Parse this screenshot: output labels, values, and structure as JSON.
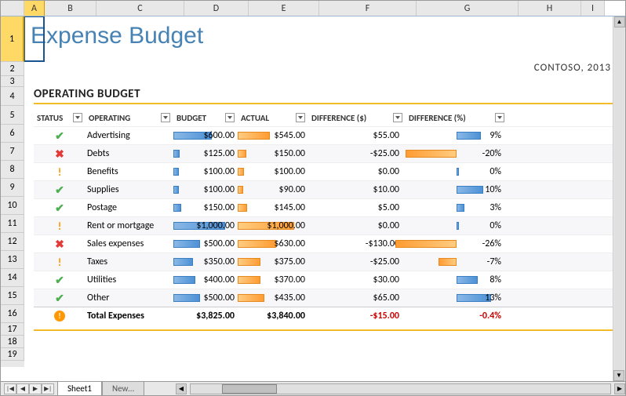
{
  "columns": [
    "A",
    "B",
    "C",
    "D",
    "E",
    "F",
    "G",
    "H",
    "I"
  ],
  "rows": [
    1,
    2,
    3,
    4,
    5,
    6,
    7,
    8,
    9,
    10,
    11,
    12,
    13,
    14,
    15,
    16,
    17,
    18,
    19
  ],
  "selected_col": "A",
  "selected_row": 1,
  "title": "Expense Budget",
  "company": "CONTOSO, 2013",
  "section_title": "OPERATING BUDGET",
  "headers": {
    "status": "STATUS",
    "operating": "OPERATING",
    "budget": "BUDGET",
    "actual": "ACTUAL",
    "diff": "DIFFERENCE ($)",
    "pct": "DIFFERENCE (%)"
  },
  "data": [
    {
      "status": "check",
      "op": "Advertising",
      "budget": "$600.00",
      "actual": "$545.00",
      "diff": "$55.00",
      "pct": "9%",
      "bw": 60,
      "aw": 45,
      "pw": 24,
      "pn": false
    },
    {
      "status": "x",
      "op": "Debts",
      "budget": "$125.00",
      "actual": "$150.00",
      "diff": "-$25.00",
      "pct": "-20%",
      "bw": 10,
      "aw": 12,
      "pw": 50,
      "pn": true
    },
    {
      "status": "warn",
      "op": "Benefits",
      "budget": "$100.00",
      "actual": "$100.00",
      "diff": "$0.00",
      "pct": "0%",
      "bw": 8,
      "aw": 9,
      "pw": 2,
      "pn": false
    },
    {
      "status": "check",
      "op": "Supplies",
      "budget": "$100.00",
      "actual": "$90.00",
      "diff": "$10.00",
      "pct": "10%",
      "bw": 8,
      "aw": 8,
      "pw": 26,
      "pn": false
    },
    {
      "status": "check",
      "op": "Postage",
      "budget": "$150.00",
      "actual": "$145.00",
      "diff": "$5.00",
      "pct": "3%",
      "bw": 12,
      "aw": 13,
      "pw": 8,
      "pn": false
    },
    {
      "status": "warn",
      "op": "Rent or mortgage",
      "budget": "$1,000.00",
      "actual": "$1,000.00",
      "diff": "$0.00",
      "pct": "0%",
      "bw": 80,
      "aw": 80,
      "pw": 2,
      "pn": false
    },
    {
      "status": "x",
      "op": "Sales expenses",
      "budget": "$500.00",
      "actual": "$630.00",
      "diff": "-$130.00",
      "pct": "-26%",
      "bw": 42,
      "aw": 54,
      "pw": 60,
      "pn": true
    },
    {
      "status": "warn",
      "op": "Taxes",
      "budget": "$350.00",
      "actual": "$375.00",
      "diff": "-$25.00",
      "pct": "-7%",
      "bw": 30,
      "aw": 32,
      "pw": 18,
      "pn": true
    },
    {
      "status": "check",
      "op": "Utilities",
      "budget": "$400.00",
      "actual": "$370.00",
      "diff": "$30.00",
      "pct": "8%",
      "bw": 34,
      "aw": 32,
      "pw": 21,
      "pn": false
    },
    {
      "status": "check",
      "op": "Other",
      "budget": "$500.00",
      "actual": "$435.00",
      "diff": "$65.00",
      "pct": "13%",
      "bw": 42,
      "aw": 38,
      "pw": 34,
      "pn": false
    }
  ],
  "total": {
    "op": "Total Expenses",
    "budget": "$3,825.00",
    "actual": "$3,840.00",
    "diff": "-$15.00",
    "pct": "-0.4%"
  },
  "tabs": {
    "active": "Sheet1",
    "inactive": "New…"
  },
  "chart_data": {
    "type": "table",
    "title": "Operating Budget",
    "columns": [
      "Operating",
      "Budget",
      "Actual",
      "Difference($)",
      "Difference(%)"
    ],
    "rows": [
      [
        "Advertising",
        600,
        545,
        55,
        9
      ],
      [
        "Debts",
        125,
        150,
        -25,
        -20
      ],
      [
        "Benefits",
        100,
        100,
        0,
        0
      ],
      [
        "Supplies",
        100,
        90,
        10,
        10
      ],
      [
        "Postage",
        150,
        145,
        5,
        3
      ],
      [
        "Rent or mortgage",
        1000,
        1000,
        0,
        0
      ],
      [
        "Sales expenses",
        500,
        630,
        -130,
        -26
      ],
      [
        "Taxes",
        350,
        375,
        -25,
        -7
      ],
      [
        "Utilities",
        400,
        370,
        30,
        8
      ],
      [
        "Other",
        500,
        435,
        65,
        13
      ]
    ],
    "total": [
      "Total Expenses",
      3825,
      3840,
      -15,
      -0.4
    ]
  }
}
